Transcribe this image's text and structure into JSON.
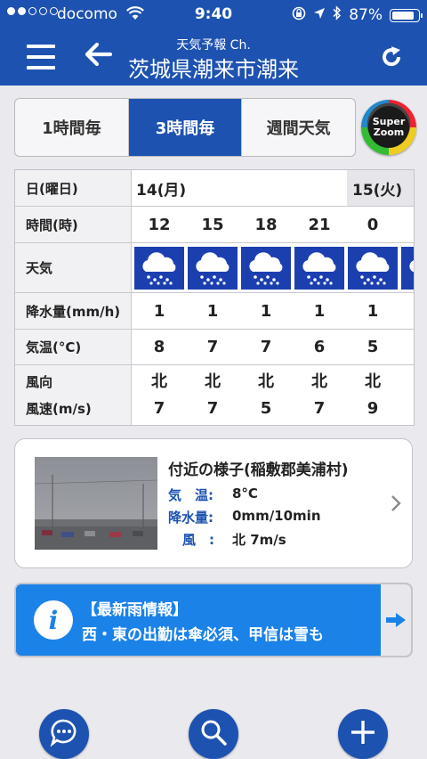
{
  "status_bar": {
    "carrier": "docomo",
    "time": "9:40",
    "battery_text": "87%",
    "battery_level": 0.87,
    "signal_bars_filled": 2,
    "signal_bars_total": 5
  },
  "header": {
    "subtitle": "天気予報 Ch.",
    "title": "茨城県潮来市潮来"
  },
  "tabs": {
    "hourly": "1時間毎",
    "three_hour": "3時間毎",
    "weekly": "週間天気",
    "active": "three_hour",
    "superzoom_line1": "Super",
    "superzoom_line2": "Zoom"
  },
  "forecast": {
    "labels": {
      "day": "日(曜日)",
      "time": "時間(時)",
      "weather": "天気",
      "precip": "降水量(mm/h)",
      "temp": "気温(°C)",
      "wind_dir": "風向",
      "wind_speed": "風速(m/s)"
    },
    "day1": "14(月)",
    "day2": "15(火)",
    "hours": [
      "12",
      "15",
      "18",
      "21",
      "0"
    ],
    "weather_icon": "rain-cloud-icon",
    "precip": [
      "1",
      "1",
      "1",
      "1",
      "1"
    ],
    "temp": [
      "8",
      "7",
      "7",
      "6",
      "5"
    ],
    "wind_dir": [
      "北",
      "北",
      "北",
      "北",
      "北"
    ],
    "wind_speed": [
      "7",
      "7",
      "5",
      "7",
      "9"
    ]
  },
  "nearby": {
    "title": "付近の様子(稲敷郡美浦村)",
    "temp_label": "気　温:",
    "temp_value": "8°C",
    "precip_label": "降水量:",
    "precip_value": "0mm/10min",
    "wind_label": "風　:",
    "wind_value": "北 7m/s"
  },
  "rain_info": {
    "headline": "【最新雨情報】",
    "text": "西・東の出勤は傘必須、甲信は雪も"
  },
  "colors": {
    "header_blue": "#1d52b0",
    "banner_blue": "#1b82e8",
    "weather_cell": "#1c3fb0"
  }
}
